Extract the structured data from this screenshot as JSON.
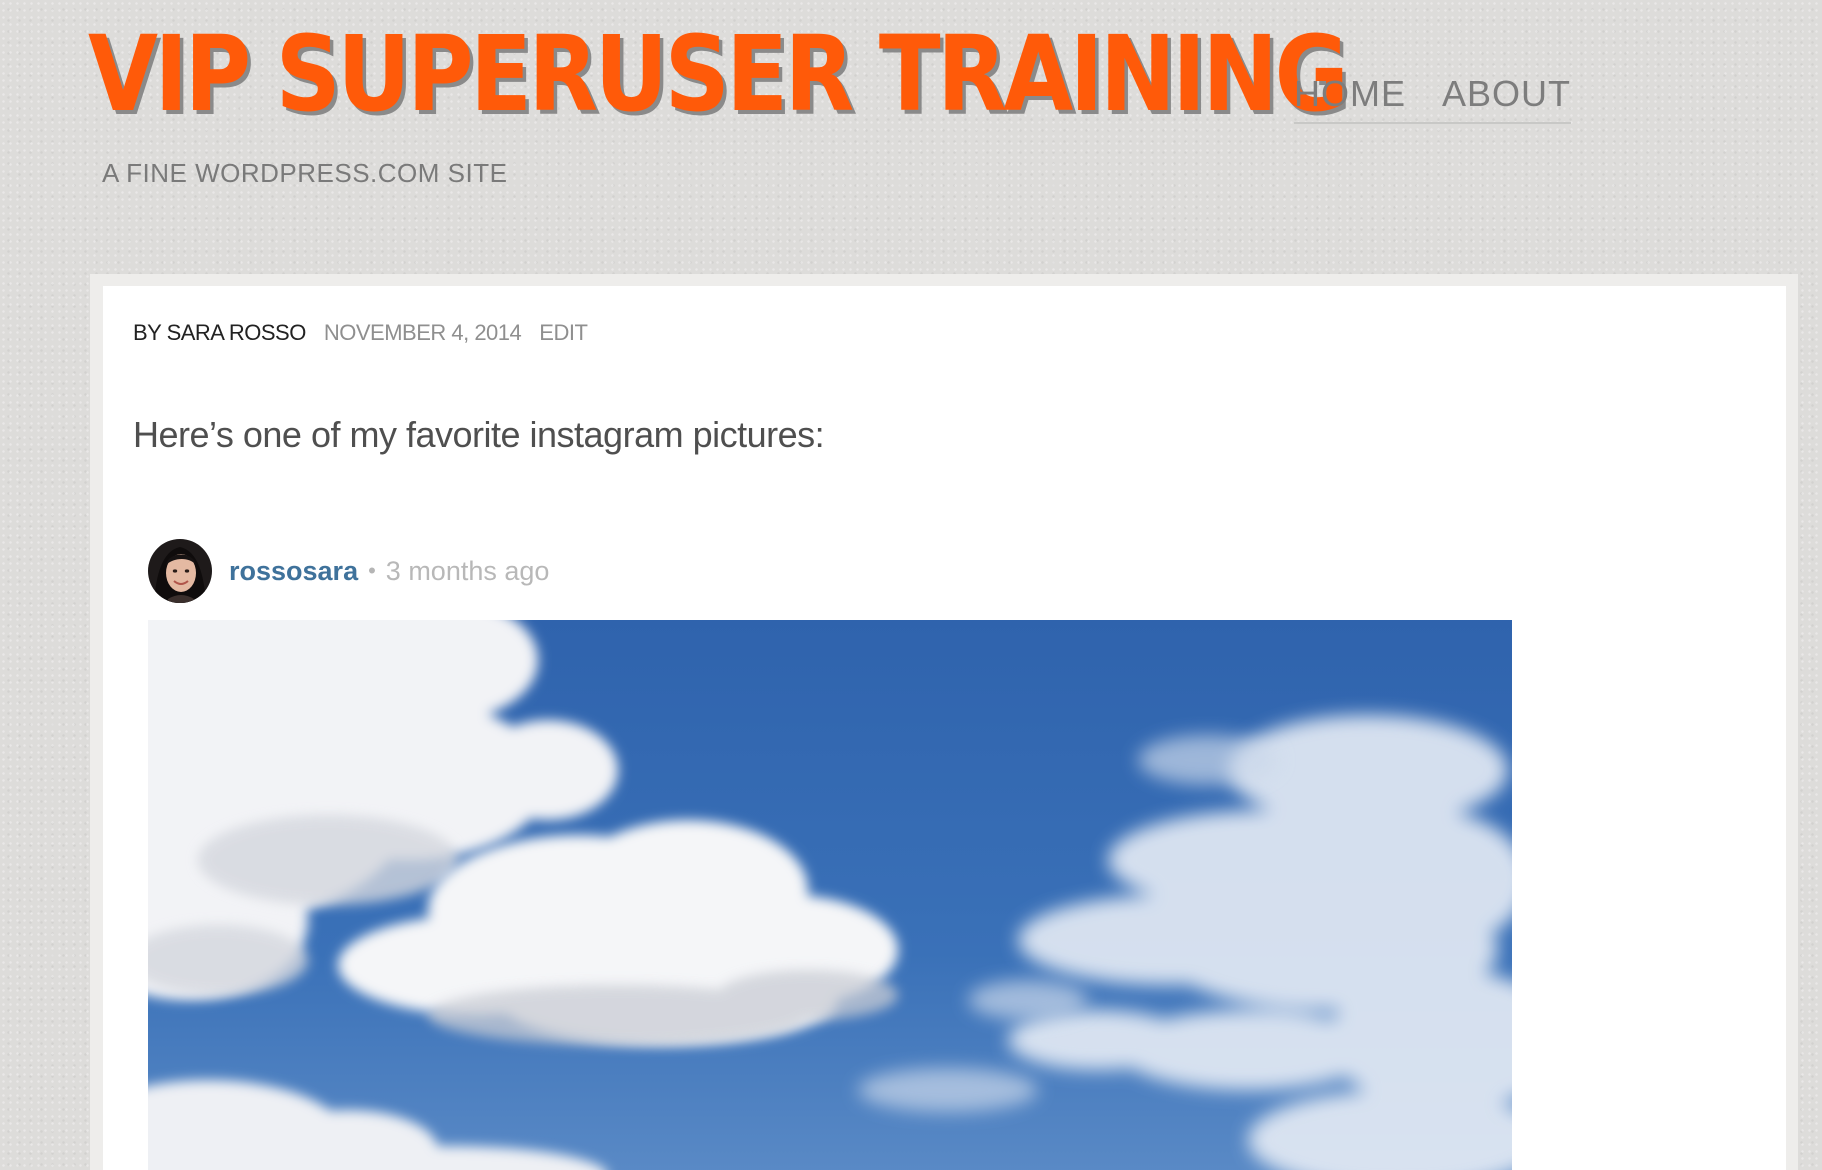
{
  "site": {
    "title": "VIP SUPERUSER TRAINING",
    "tagline": "A FINE WORDPRESS.COM SITE",
    "accent_color": "#ff5a09"
  },
  "nav": {
    "items": [
      {
        "label": "HOME"
      },
      {
        "label": "ABOUT"
      }
    ]
  },
  "post": {
    "byline": "BY SARA ROSSO",
    "date": "NOVEMBER 4, 2014",
    "edit_label": "EDIT",
    "text": "Here’s one of my favorite instagram pictures:"
  },
  "instagram": {
    "username": "rossosara",
    "separator": "•",
    "time_ago": "3 months ago",
    "username_color": "#3f729b",
    "photo_subject": "blue sky with white clouds"
  }
}
